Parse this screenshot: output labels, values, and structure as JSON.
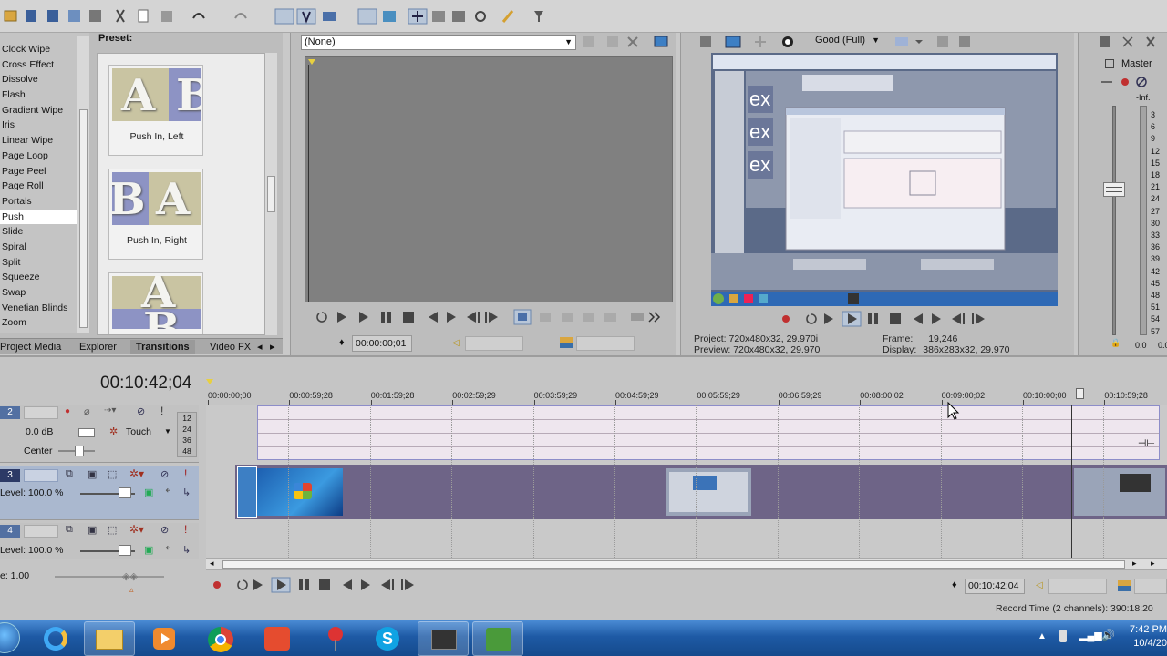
{
  "transitions": {
    "list": [
      "Clock Wipe",
      "Cross Effect",
      "Dissolve",
      "Flash",
      "Gradient Wipe",
      "Iris",
      "Linear Wipe",
      "Page Loop",
      "Page Peel",
      "Page Roll",
      "Portals",
      "Push",
      "Slide",
      "Spiral",
      "Split",
      "Squeeze",
      "Swap",
      "Venetian Blinds",
      "Zoom"
    ],
    "selected": "Push",
    "preset_label": "Preset:",
    "presets": [
      {
        "caption": "Push In, Left",
        "letters": [
          "A",
          "B"
        ]
      },
      {
        "caption": "Push In, Right",
        "letters": [
          "B",
          "A"
        ]
      },
      {
        "caption": "",
        "letters": [
          "A",
          "B"
        ]
      }
    ]
  },
  "tabs": [
    "Project Media",
    "Explorer",
    "Transitions",
    "Video FX"
  ],
  "active_tab": "Transitions",
  "trimmer": {
    "source": "(None)",
    "time": "00:00:00;01"
  },
  "preview": {
    "quality": "Good (Full)",
    "project_label": "Project:",
    "project_value": "720x480x32, 29.970i",
    "preview_label": "Preview:",
    "preview_value": "720x480x32, 29.970i",
    "frame_label": "Frame:",
    "frame_value": "19,246",
    "display_label": "Display:",
    "display_value": "386x283x32, 29.970"
  },
  "master": {
    "label": "Master",
    "peak": "-Inf.",
    "scale": [
      "3",
      "6",
      "9",
      "12",
      "15",
      "18",
      "21",
      "24",
      "27",
      "30",
      "33",
      "36",
      "39",
      "42",
      "45",
      "48",
      "51",
      "54",
      "57"
    ],
    "bottom_left": "0.0",
    "bottom_right": "0.0"
  },
  "timeline": {
    "cursor_time": "00:10:42;04",
    "ruler": [
      "00:00:00;00",
      "00:00:59;28",
      "00:01:59;28",
      "00:02:59;29",
      "00:03:59;29",
      "00:04:59;29",
      "00:05:59;29",
      "00:06:59;29",
      "00:08:00;02",
      "00:09:00;02",
      "00:10:00;00",
      "00:10:59;28"
    ],
    "tracks": [
      {
        "number": "2",
        "volume": "0.0 dB",
        "mode": "Touch",
        "pan": "Center",
        "meter": [
          "12",
          "24",
          "36",
          "48"
        ]
      },
      {
        "number": "3",
        "level": "Level: 100.0 %"
      },
      {
        "number": "4",
        "level": "Level: 100.0 %"
      }
    ],
    "rate": "e: 1.00",
    "transport_time": "00:10:42;04",
    "record_time": "Record Time (2 channels): 390:18:20"
  },
  "taskbar": {
    "apps": [
      "start-orb",
      "internet-explorer",
      "file-explorer",
      "media-player",
      "chrome",
      "presentation-app",
      "pushpin-app",
      "skype",
      "media-tool",
      "vegas-pro"
    ],
    "time": "7:42 PM",
    "date": "10/4/20"
  },
  "colors": {
    "accent": "#6b86ad",
    "audio_track": "#eee6ee",
    "video_track": "#6e6487",
    "taskbar": "#1e5aa5"
  }
}
